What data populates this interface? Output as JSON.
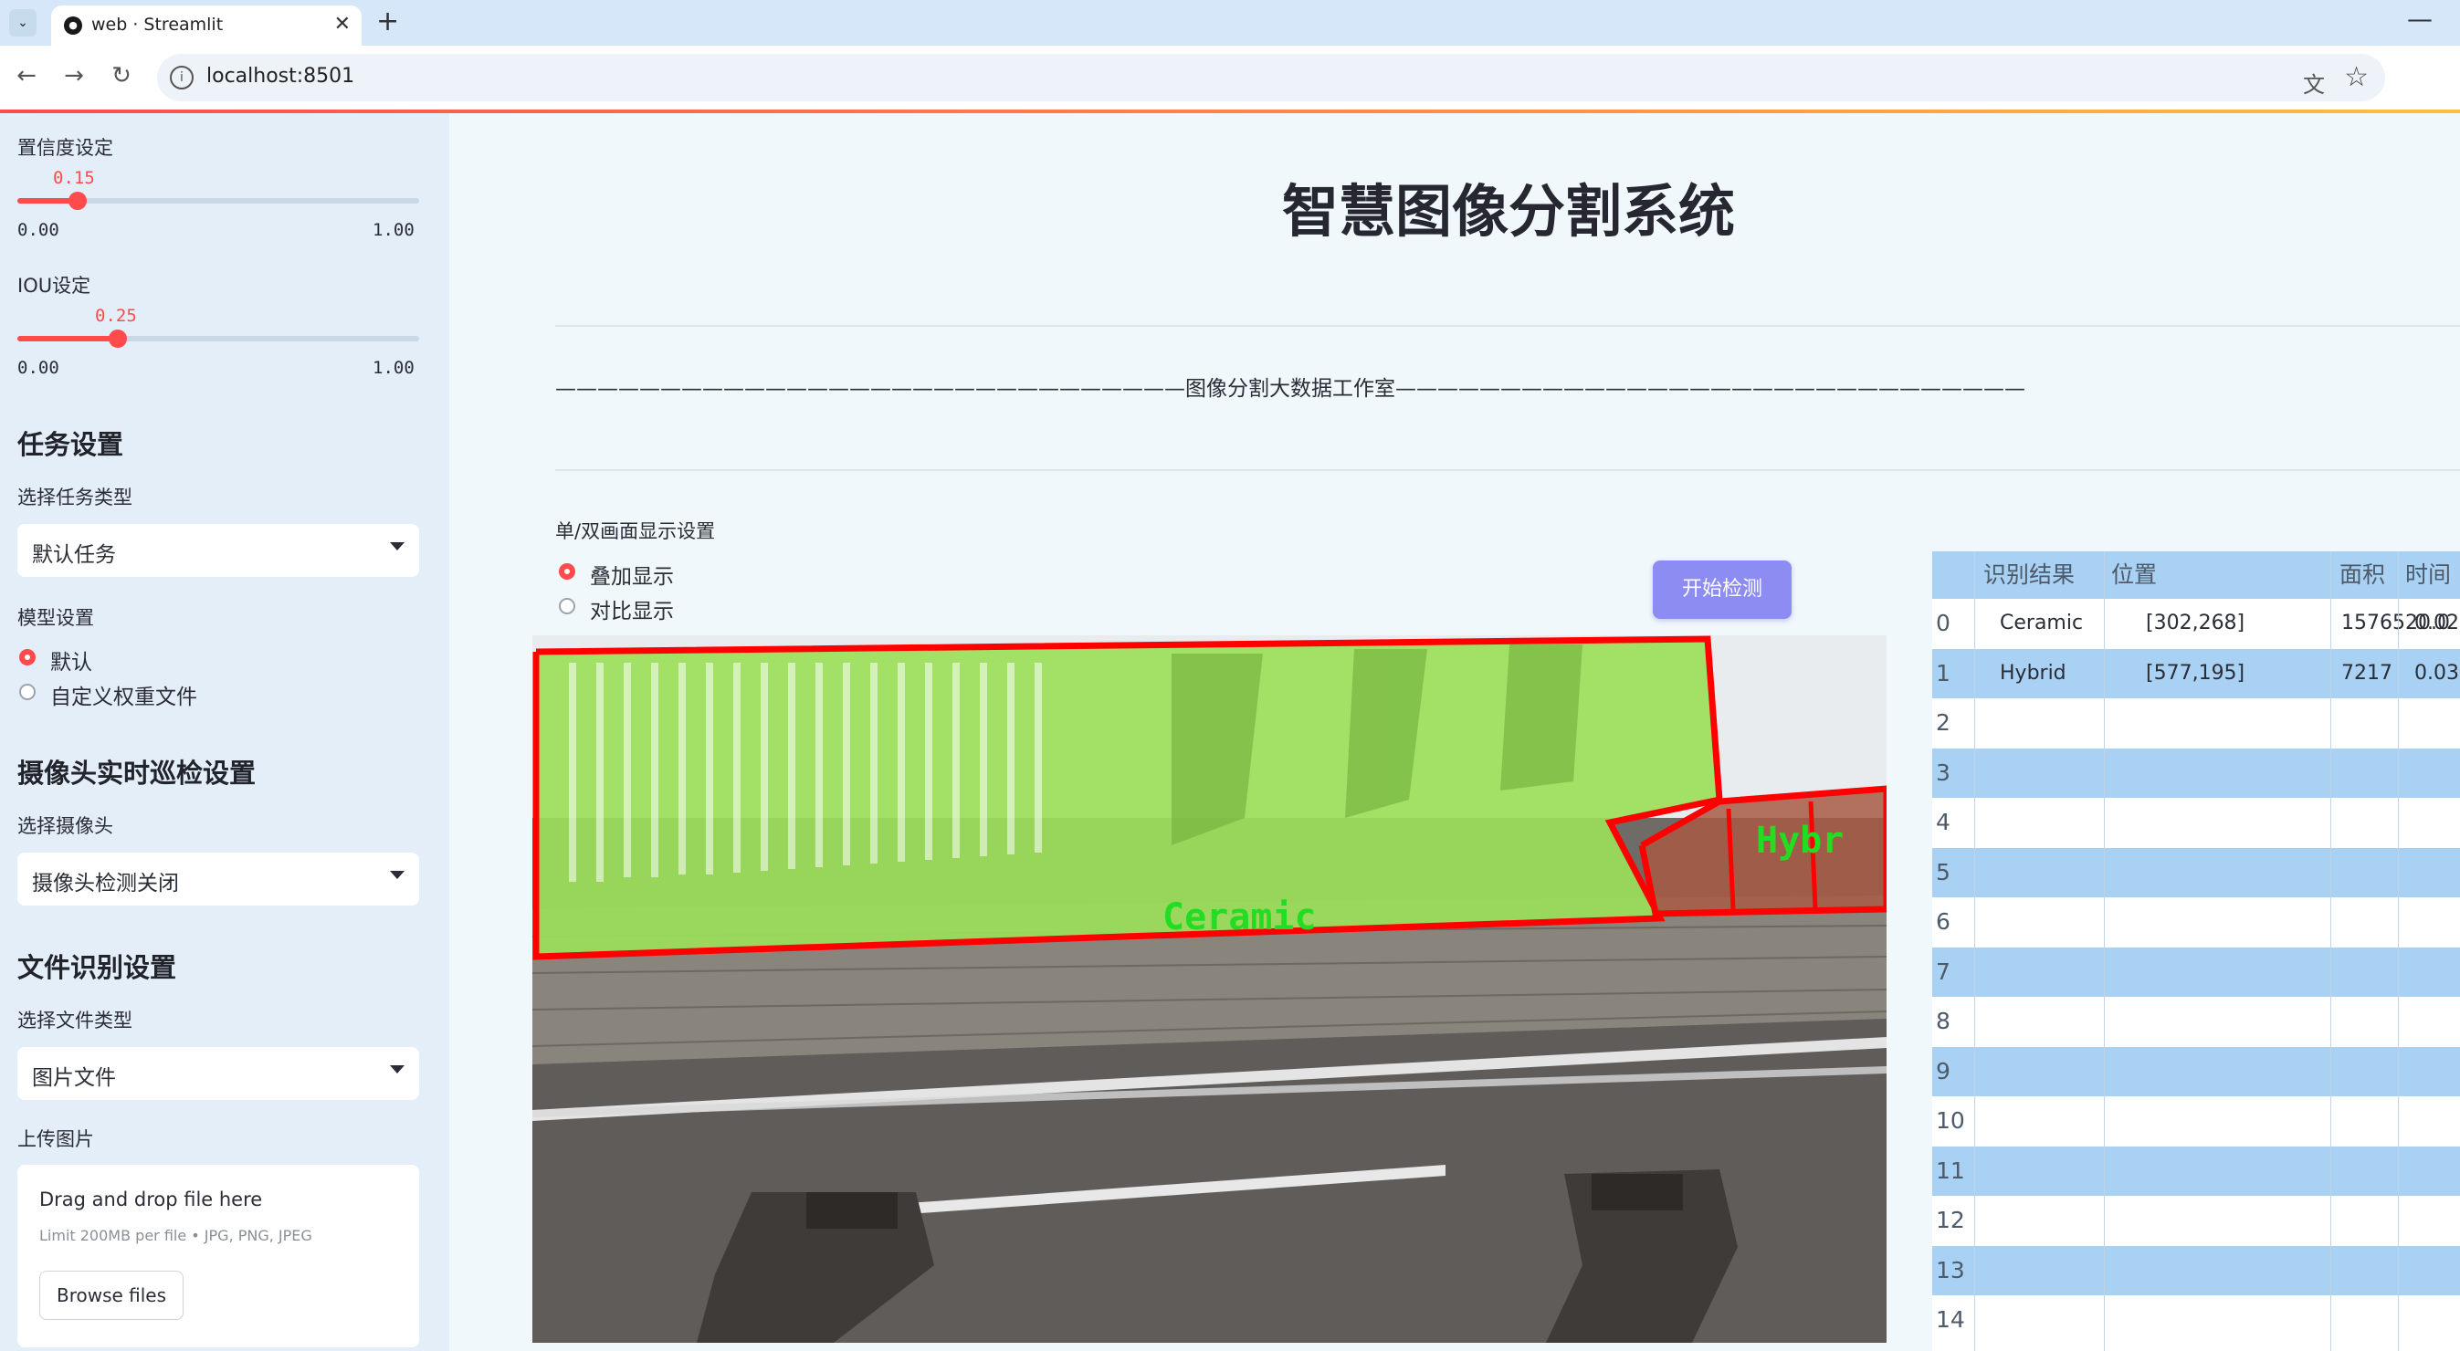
{
  "browser": {
    "tab_title": "web · Streamlit",
    "url": "localhost:8501"
  },
  "sidebar": {
    "confidence": {
      "label": "置信度设定",
      "value": "0.15",
      "value_num": 0.15,
      "min": "0.00",
      "max": "1.00"
    },
    "iou": {
      "label": "IOU设定",
      "value": "0.25",
      "value_num": 0.25,
      "min": "0.00",
      "max": "1.00"
    },
    "task_section": "任务设置",
    "task_type_label": "选择任务类型",
    "task_type_value": "默认任务",
    "model_label": "模型设置",
    "model_options": [
      "默认",
      "自定义权重文件"
    ],
    "model_selected": 0,
    "camera_section": "摄像头实时巡检设置",
    "camera_label": "选择摄像头",
    "camera_value": "摄像头检测关闭",
    "file_section": "文件识别设置",
    "file_type_label": "选择文件类型",
    "file_type_value": "图片文件",
    "upload_label": "上传图片",
    "upload_title": "Drag and drop file here",
    "upload_limit": "Limit 200MB per file • JPG, PNG, JPEG",
    "browse_label": "Browse files"
  },
  "main": {
    "title": "智慧图像分割系统",
    "banner": "——————————————————————————————图像分割大数据工作室——————————————————————————————",
    "display_mode_label": "单/双画面显示设置",
    "display_options": [
      "叠加显示",
      "对比显示"
    ],
    "display_selected": 0,
    "start_button": "开始检测"
  },
  "image": {
    "labels": [
      "Ceramic",
      "Hybr"
    ],
    "colors": {
      "mask": "#9be05a",
      "outline": "#ff0000",
      "label": "#22dd22",
      "hybrid_fill": "#a85a44"
    }
  },
  "results": {
    "headers": [
      "识别结果",
      "位置",
      "面积",
      "时间"
    ],
    "rows": [
      {
        "index": "0",
        "label": "Ceramic",
        "pos": "[302,268]",
        "area": "1576520.0",
        "time": "0.02"
      },
      {
        "index": "1",
        "label": "Hybrid",
        "pos": "[577,195]",
        "area": "7217",
        "time": "0.03"
      },
      {
        "index": "2",
        "label": "",
        "pos": "",
        "area": "",
        "time": ""
      },
      {
        "index": "3",
        "label": "",
        "pos": "",
        "area": "",
        "time": ""
      },
      {
        "index": "4",
        "label": "",
        "pos": "",
        "area": "",
        "time": ""
      },
      {
        "index": "5",
        "label": "",
        "pos": "",
        "area": "",
        "time": ""
      },
      {
        "index": "6",
        "label": "",
        "pos": "",
        "area": "",
        "time": ""
      },
      {
        "index": "7",
        "label": "",
        "pos": "",
        "area": "",
        "time": ""
      },
      {
        "index": "8",
        "label": "",
        "pos": "",
        "area": "",
        "time": ""
      },
      {
        "index": "9",
        "label": "",
        "pos": "",
        "area": "",
        "time": ""
      },
      {
        "index": "10",
        "label": "",
        "pos": "",
        "area": "",
        "time": ""
      },
      {
        "index": "11",
        "label": "",
        "pos": "",
        "area": "",
        "time": ""
      },
      {
        "index": "12",
        "label": "",
        "pos": "",
        "area": "",
        "time": ""
      },
      {
        "index": "13",
        "label": "",
        "pos": "",
        "area": "",
        "time": ""
      },
      {
        "index": "14",
        "label": "",
        "pos": "",
        "area": "",
        "time": ""
      }
    ]
  }
}
